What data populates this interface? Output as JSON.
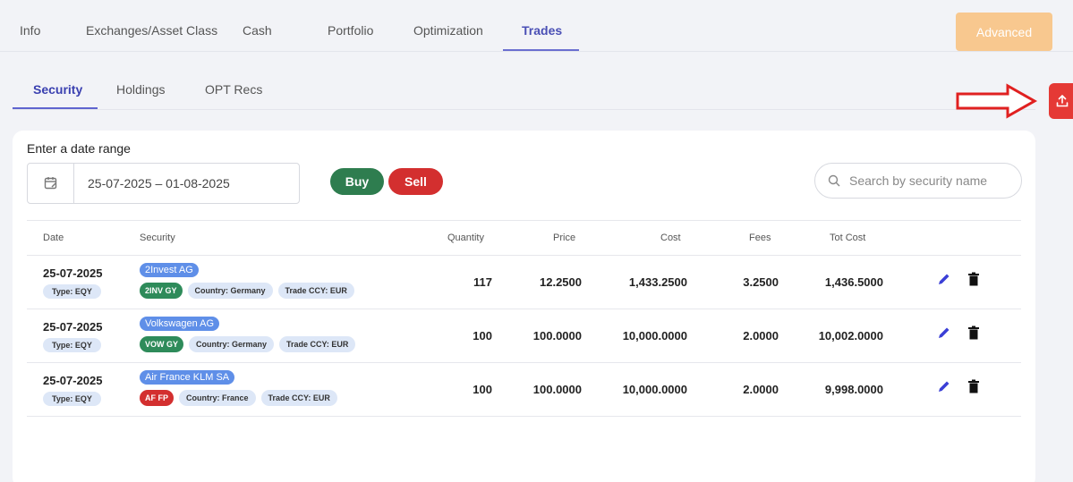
{
  "top_tabs": [
    "Info",
    "Exchanges/Asset Class",
    "Cash",
    "Portfolio",
    "Optimization",
    "Trades"
  ],
  "advanced_label": "Advanced",
  "sub_tabs": [
    "Security",
    "Holdings",
    "OPT Recs"
  ],
  "date_range": {
    "label": "Enter a date range",
    "value": "25-07-2025 – 01-08-2025"
  },
  "buy_label": "Buy",
  "sell_label": "Sell",
  "search": {
    "placeholder": "Search by security name"
  },
  "columns": [
    "Date",
    "Security",
    "Quantity",
    "Price",
    "Cost",
    "Fees",
    "Tot Cost"
  ],
  "rows": [
    {
      "date": "25-07-2025",
      "type": "Type: EQY",
      "security": "2Invest AG",
      "ticker": "2INV GY",
      "ticker_color": "#2e8b5a",
      "country": "Country: Germany",
      "ccy": "Trade CCY: EUR",
      "quantity": "117",
      "price": "12.2500",
      "cost": "1,433.2500",
      "fees": "3.2500",
      "tot_cost": "1,436.5000"
    },
    {
      "date": "25-07-2025",
      "type": "Type: EQY",
      "security": "Volkswagen AG",
      "ticker": "VOW GY",
      "ticker_color": "#2e8b5a",
      "country": "Country: Germany",
      "ccy": "Trade CCY: EUR",
      "quantity": "100",
      "price": "100.0000",
      "cost": "10,000.0000",
      "fees": "2.0000",
      "tot_cost": "10,002.0000"
    },
    {
      "date": "25-07-2025",
      "type": "Type: EQY",
      "security": "Air France KLM SA",
      "ticker": "AF FP",
      "ticker_color": "#d32f2f",
      "country": "Country: France",
      "ccy": "Trade CCY: EUR",
      "quantity": "100",
      "price": "100.0000",
      "cost": "10,000.0000",
      "fees": "2.0000",
      "tot_cost": "9,998.0000"
    }
  ],
  "colors": {
    "accent": "#4a4fb5",
    "buy": "#2e7d4f",
    "sell": "#d32f2f",
    "advanced": "#f8c88f",
    "edit": "#3b3fd6"
  }
}
